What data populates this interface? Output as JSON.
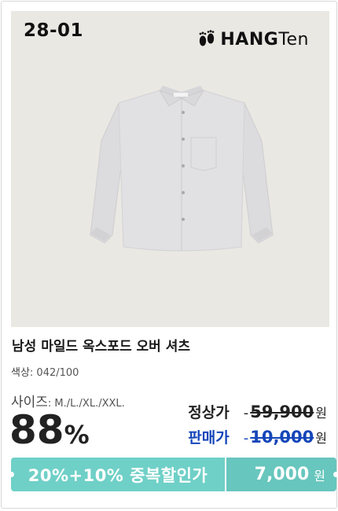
{
  "product": {
    "code": "28-01",
    "brand": {
      "bold": "HANG",
      "light": "Ten"
    },
    "title": "남성 마일드 옥스포드 오버 셔츠",
    "color_label": "색상",
    "color_value": ": 042/100",
    "size_label": "사이즈",
    "size_value": ": M./L./XL./XXL.",
    "discount_percent": "88",
    "percent_symbol": "%"
  },
  "prices": {
    "regular_label": "정상가",
    "regular_value": "59,900",
    "sale_label": "판매가",
    "sale_value": "10,000",
    "currency": "원",
    "dash": "-"
  },
  "banner": {
    "text": "20%+10% 중복할인가",
    "price": "7,000",
    "currency": "원"
  },
  "colors": {
    "photo_bg": "#e9e8e3",
    "sale_blue": "#1546b9",
    "banner_teal": "#6fd0c7"
  },
  "icons": {
    "brand_logo": "footprints-icon",
    "product_image": "shirt-image"
  }
}
